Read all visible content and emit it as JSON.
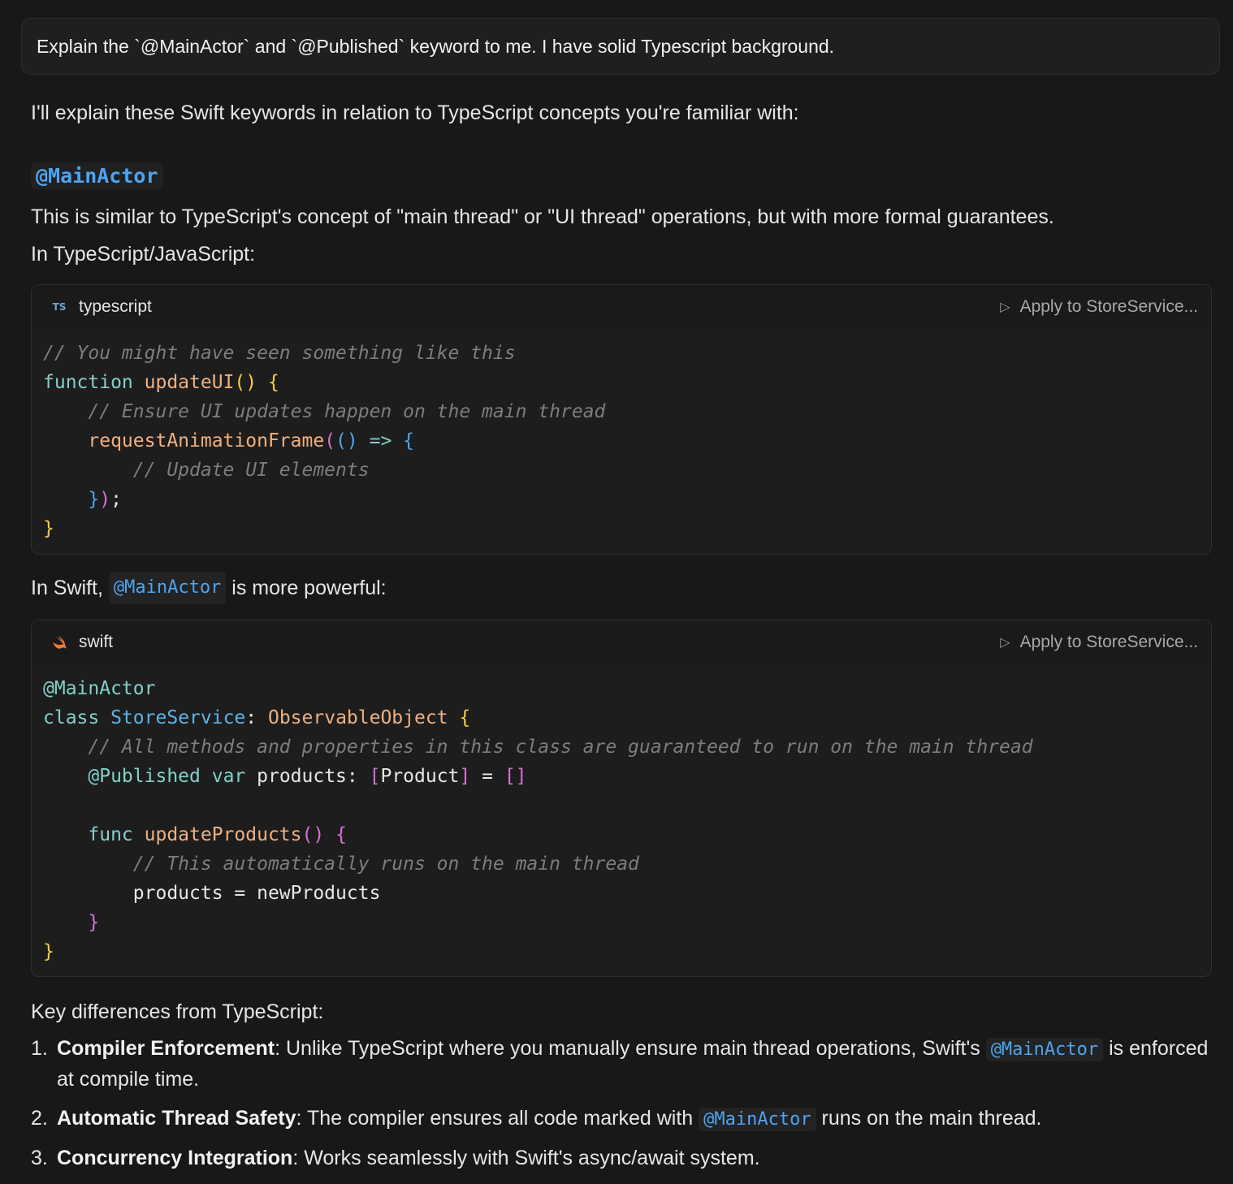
{
  "user_message": "Explain the `@MainActor` and `@Published` keyword to me. I have solid Typescript background.",
  "response": {
    "intro": "I'll explain these Swift keywords in relation to TypeScript concepts you're familiar with:",
    "heading": "@MainActor",
    "para1": "This is similar to TypeScript's concept of \"main thread\" or \"UI thread\" operations, but with more formal guarantees.",
    "para2": "In TypeScript/JavaScript:",
    "swift_intro_prefix": "In Swift,",
    "swift_intro_code": "@MainActor",
    "swift_intro_suffix": "is more powerful:",
    "key_diff_title": "Key differences from TypeScript:",
    "diffs": [
      {
        "num": "1.",
        "bold": "Compiler Enforcement",
        "pre": ": Unlike TypeScript where you manually ensure main thread operations, Swift's ",
        "code": "@MainActor",
        "post": " is enforced at compile time."
      },
      {
        "num": "2.",
        "bold": "Automatic Thread Safety",
        "pre": ": The compiler ensures all code marked with ",
        "code": "@MainActor",
        "post": " runs on the main thread."
      },
      {
        "num": "3.",
        "bold": "Concurrency Integration",
        "pre": ": Works seamlessly with Swift's async/await system.",
        "code": "",
        "post": ""
      }
    ]
  },
  "code_blocks": {
    "ts": {
      "icon_text": "TS",
      "icon_name": "typescript-icon",
      "lang": "typescript",
      "apply_label": "Apply to StoreService...",
      "lines": [
        "// You might have seen something like this",
        "function updateUI() {",
        "    // Ensure UI updates happen on the main thread",
        "    requestAnimationFrame(() => {",
        "        // Update UI elements",
        "    });",
        "}"
      ]
    },
    "swift": {
      "icon_name": "swift-icon",
      "lang": "swift",
      "apply_label": "Apply to StoreService...",
      "lines": [
        "@MainActor",
        "class StoreService: ObservableObject {",
        "    // All methods and properties in this class are guaranteed to run on the main thread",
        "    @Published var products: [Product] = []",
        "",
        "    func updateProducts() {",
        "        // This automatically runs on the main thread",
        "        products = newProducts",
        "    }",
        "}"
      ]
    }
  },
  "colors": {
    "background": "#181818",
    "accent_blue": "#4ea4f0",
    "keyword": "#83d0c9",
    "function": "#efb080",
    "bracket_yellow": "#f4d03f",
    "bracket_pink": "#d670d6",
    "comment": "#7d7d7d"
  }
}
